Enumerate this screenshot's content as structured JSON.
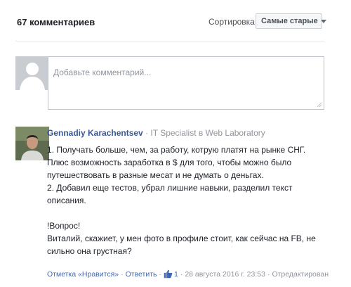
{
  "header": {
    "count": "67 комментариев",
    "sort_label": "Сортировка",
    "sort_value": "Самые старые"
  },
  "compose": {
    "placeholder": "Добавьте комментарий..."
  },
  "comment": {
    "author": "Gennadiy Karachentsev",
    "separator": "·",
    "role": "IT Specialist в Web Laboratory",
    "text_lines": [
      "1. Получать больше, чем, за работу, котрую платят на рынке СНГ. Плюс возможность заработка в $ для того, чтобы можно было путешествовать в разные месат и не думать о деньгах.",
      "2. Добавил еще тестов, убрал лишние навыки, разделил текст описания.",
      "",
      "!Вопрос!",
      "Виталий, скажиет, у мен фото в профиле стоит, как сейчас на FB, не сильно она грустная?"
    ],
    "actions": {
      "like": "Отметка «Нравится»",
      "reply": "Ответить",
      "likes_count": "1",
      "date": "28 августа 2016 г. 23:53",
      "edited": "Отредактирован"
    }
  },
  "colors": {
    "link": "#4267b2",
    "author": "#365899",
    "muted": "#90949c"
  }
}
